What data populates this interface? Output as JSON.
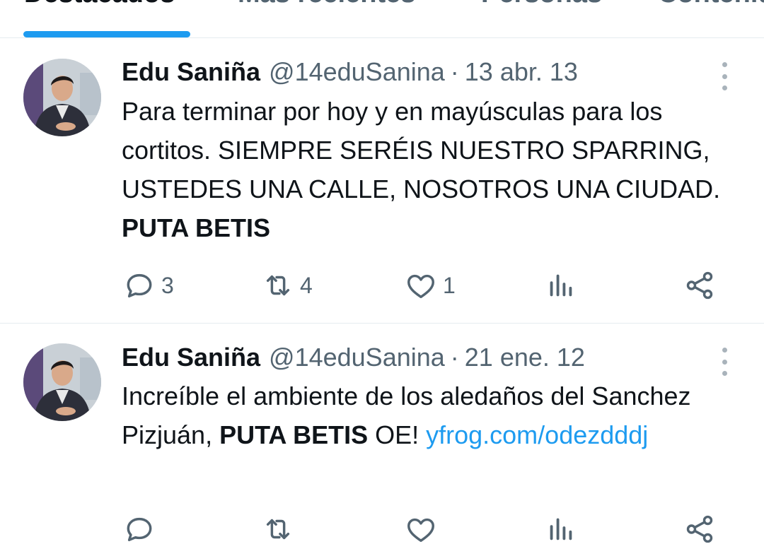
{
  "tabs": [
    {
      "label": "Destacados",
      "active": true
    },
    {
      "label": "Más recientes",
      "active": false
    },
    {
      "label": "Personas",
      "active": false
    },
    {
      "label": "Contenido",
      "active": false
    }
  ],
  "colors": {
    "accent": "#1d9bf0",
    "text": "#0f1419",
    "muted": "#536471",
    "divider": "#e6ecf0"
  },
  "tweets": [
    {
      "name": "Edu Saniña",
      "handle": "@14eduSanina",
      "separator": "·",
      "date": "13 abr. 13",
      "text_plain": "Para terminar por hoy y en mayúsculas para los cortitos. SIEMPRE SERÉIS NUESTRO SPARRING, USTEDES UNA CALLE, NOSOTROS UNA CIUDAD. ",
      "text_bold": "PUTA BETIS",
      "replies": "3",
      "retweets": "4",
      "likes": "1"
    },
    {
      "name": "Edu Saniña",
      "handle": "@14eduSanina",
      "separator": "·",
      "date": "21 ene. 12",
      "text_plain": "Increíble el ambiente de los aledaños del Sanchez Pizjuán, ",
      "text_bold": "PUTA BETIS",
      "text_after": " OE! ",
      "link": "yfrog.com/odezdddj"
    }
  ],
  "icons": [
    "reply-icon",
    "retweet-icon",
    "like-icon",
    "views-icon",
    "share-icon",
    "more-icon"
  ]
}
